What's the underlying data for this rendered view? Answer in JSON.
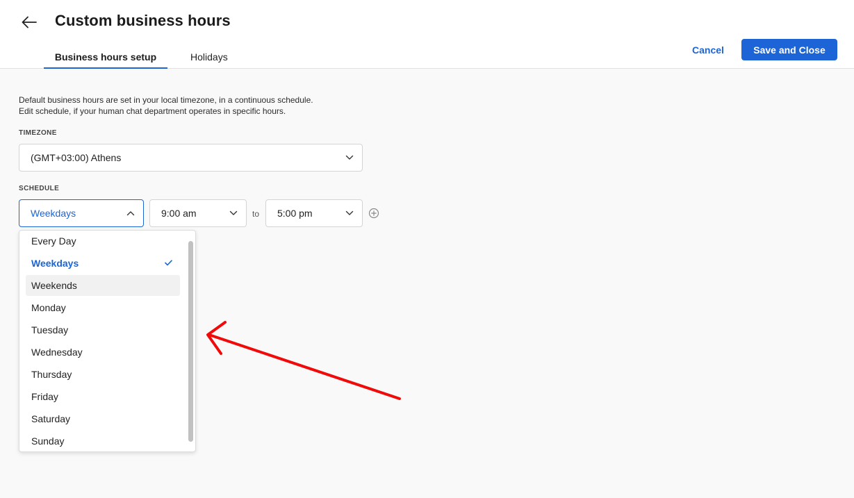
{
  "header": {
    "title": "Custom business hours",
    "back_icon": "arrow-left-icon",
    "tabs": [
      {
        "label": "Business hours setup",
        "active": true
      },
      {
        "label": "Holidays",
        "active": false
      }
    ],
    "cancel_label": "Cancel",
    "save_label": "Save and Close"
  },
  "content": {
    "description_line1": "Default business hours are set in your local timezone, in a continuous schedule.",
    "description_line2": "Edit schedule, if your human chat department operates in specific hours.",
    "timezone": {
      "label": "TIMEZONE",
      "value": "(GMT+03:00) Athens"
    },
    "schedule": {
      "label": "SCHEDULE",
      "days_value": "Weekdays",
      "start_time": "9:00 am",
      "to_label": "to",
      "end_time": "5:00 pm",
      "add_icon": "plus-circle-icon"
    }
  },
  "dropdown": {
    "open": true,
    "options": [
      {
        "label": "Every Day",
        "selected": false,
        "hover": false
      },
      {
        "label": "Weekdays",
        "selected": true,
        "hover": false
      },
      {
        "label": "Weekends",
        "selected": false,
        "hover": true
      },
      {
        "label": "Monday",
        "selected": false,
        "hover": false
      },
      {
        "label": "Tuesday",
        "selected": false,
        "hover": false
      },
      {
        "label": "Wednesday",
        "selected": false,
        "hover": false
      },
      {
        "label": "Thursday",
        "selected": false,
        "hover": false
      },
      {
        "label": "Friday",
        "selected": false,
        "hover": false
      },
      {
        "label": "Saturday",
        "selected": false,
        "hover": false
      },
      {
        "label": "Sunday",
        "selected": false,
        "hover": false
      }
    ]
  },
  "annotation": {
    "arrow_icon": "red-arrow-annotation",
    "color": "#f00a0a"
  },
  "colors": {
    "accent": "#1d64d6",
    "background": "#f9f9f9",
    "hover": "#f1f1f1"
  }
}
